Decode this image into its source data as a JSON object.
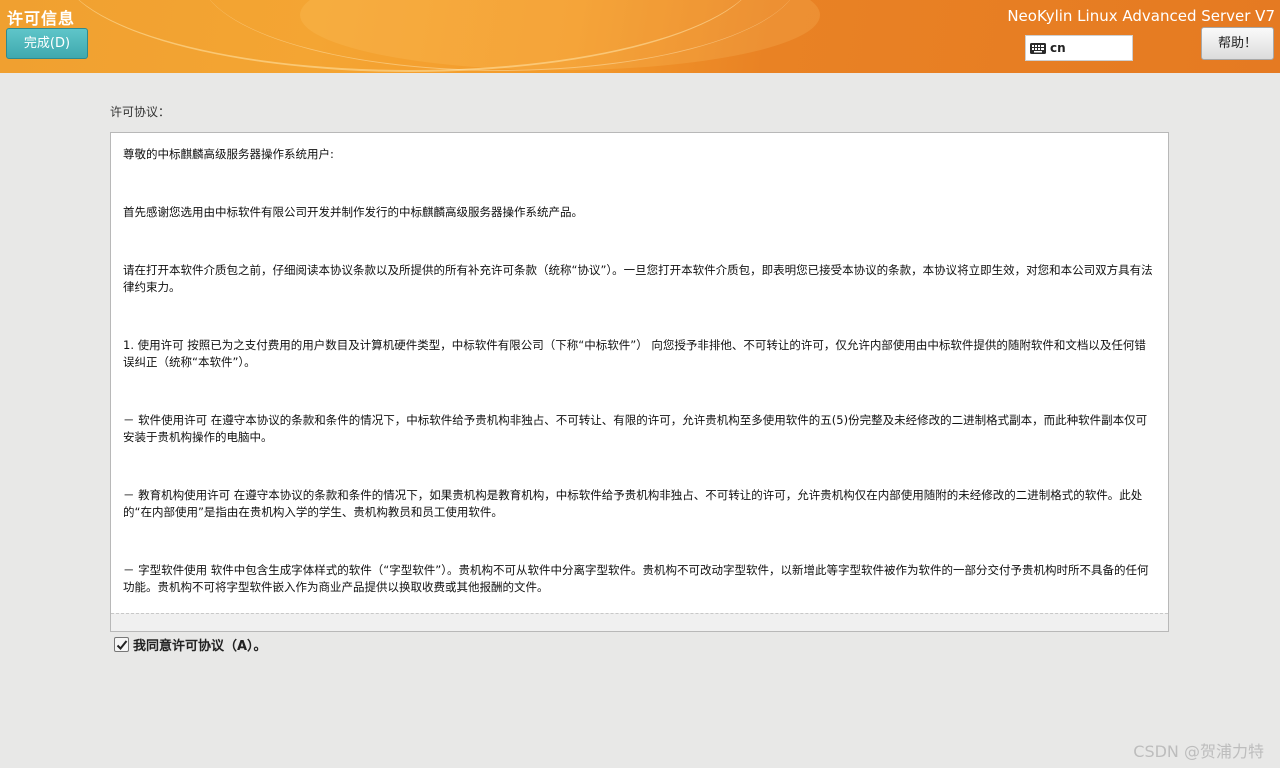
{
  "header": {
    "title": "许可信息",
    "done_label": "完成(D)",
    "product": "NeoKylin Linux Advanced Server V7",
    "keyboard_layout": "cn",
    "help_label": "帮助！",
    "colors": {
      "accent_orange": "#f0a030",
      "done_button": "#4fb8bd"
    }
  },
  "license": {
    "section_label": "许可协议：",
    "greeting": "尊敬的中标麒麟高级服务器操作系统用户:",
    "paragraphs": [
      " 首先感谢您选用由中标软件有限公司开发并制作发行的中标麒麟高级服务器操作系统产品。",
      " 请在打开本软件介质包之前，仔细阅读本协议条款以及所提供的所有补充许可条款（统称“协议”）。一旦您打开本软件介质包，即表明您已接受本协议的条款，本协议将立即生效，对您和本公司双方具有法律约束力。",
      " 1. 使用许可 按照已为之支付费用的用户数目及计算机硬件类型，中标软件有限公司（下称“中标软件”） 向您授予非排他、不可转让的许可，仅允许内部使用由中标软件提供的随附软件和文档以及任何错误纠正（统称“本软件”）。",
      " － 软件使用许可 在遵守本协议的条款和条件的情况下，中标软件给予贵机构非独占、不可转让、有限的许可，允许贵机构至多使用软件的五(5)份完整及未经修改的二进制格式副本，而此种软件副本仅可安装于贵机构操作的电脑中。",
      " － 教育机构使用许可 在遵守本协议的条款和条件的情况下，如果贵机构是教育机构，中标软件给予贵机构非独占、不可转让的许可，允许贵机构仅在内部使用随附的未经修改的二进制格式的软件。此处的“在内部使用”是指由在贵机构入学的学生、贵机构教员和员工使用软件。",
      " － 字型软件使用 软件中包含生成字体样式的软件（“字型软件”）。贵机构不可从软件中分离字型软件。贵机构不可改动字型软件，以新增此等字型软件被作为软件的一部分交付予贵机构时所不具备的任何功能。贵机构不可将字型软件嵌入作为商业产品提供以换取收费或其他报酬的文件。"
    ],
    "agree_label": "我同意许可协议（A）。",
    "agree_checked": true
  },
  "watermark": "CSDN @贺浦力特"
}
